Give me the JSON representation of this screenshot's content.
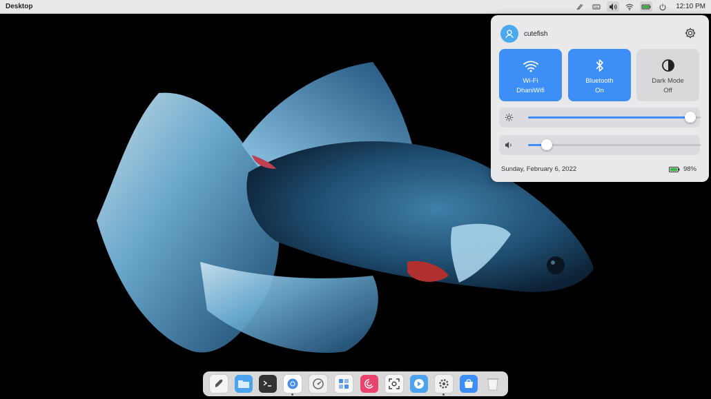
{
  "topbar": {
    "title": "Desktop",
    "clock": "12:10 PM",
    "tray_icons": [
      "pen-icon",
      "keyboard-icon",
      "volume-icon",
      "wifi-icon",
      "battery-icon",
      "power-icon"
    ]
  },
  "control_center": {
    "username": "cutefish",
    "tiles": [
      {
        "label": "Wi-Fi",
        "status": "DhaniWifi",
        "state": "on",
        "icon": "wifi-icon"
      },
      {
        "label": "Bluetooth",
        "status": "On",
        "state": "on",
        "icon": "bluetooth-icon"
      },
      {
        "label": "Dark Mode",
        "status": "Off",
        "state": "off",
        "icon": "dark-mode-icon"
      }
    ],
    "brightness": 0.97,
    "volume": 0.08,
    "date": "Sunday, February 6, 2022",
    "battery": "98%"
  },
  "dock": {
    "apps": [
      "launcher-icon",
      "files-icon",
      "terminal-icon",
      "browser-icon",
      "system-monitor-icon",
      "calculator-icon",
      "debian-icon",
      "screenshot-icon",
      "video-player-icon",
      "settings-icon",
      "app-store-icon",
      "trash-icon"
    ]
  },
  "colors": {
    "accent": "#3d8ef7",
    "panel": "#e9e9ec"
  }
}
